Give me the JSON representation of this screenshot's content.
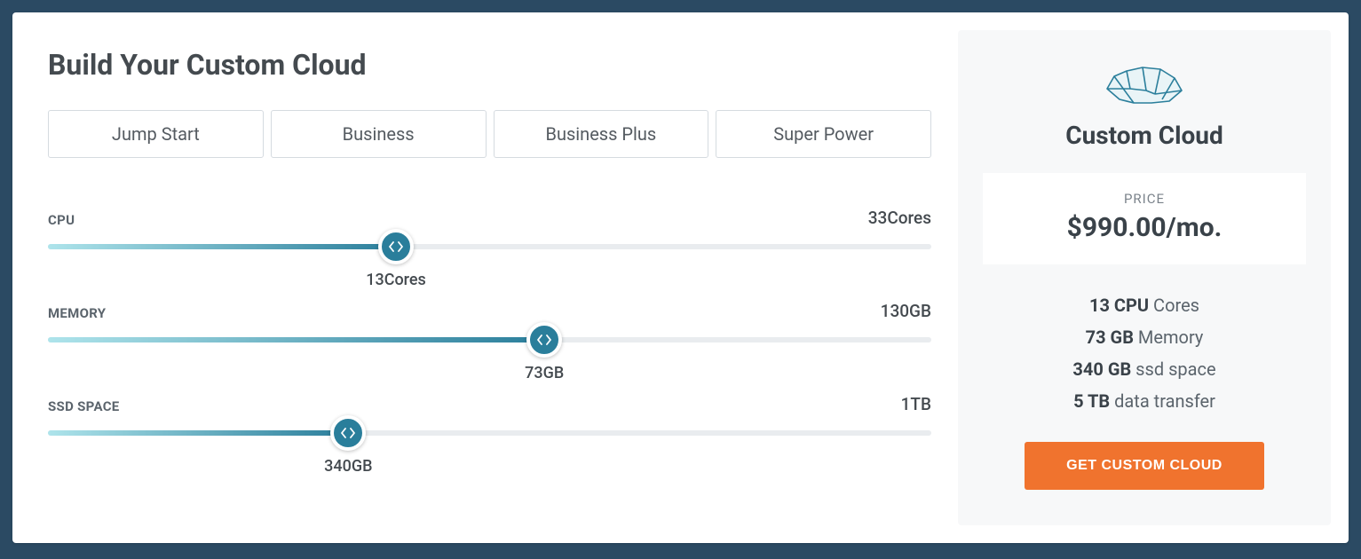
{
  "title": "Build Your Custom Cloud",
  "tabs": [
    {
      "label": "Jump Start"
    },
    {
      "label": "Business"
    },
    {
      "label": "Business Plus"
    },
    {
      "label": "Super Power"
    }
  ],
  "sliders": {
    "cpu": {
      "label": "CPU",
      "max_label": "33Cores",
      "value_label": "13Cores",
      "percent": 39.4
    },
    "memory": {
      "label": "MEMORY",
      "max_label": "130GB",
      "value_label": "73GB",
      "percent": 56.2
    },
    "ssd": {
      "label": "SSD SPACE",
      "max_label": "1TB",
      "value_label": "340GB",
      "percent": 34.0
    }
  },
  "summary": {
    "heading": "Custom Cloud",
    "price_label": "PRICE",
    "price_value": "$990.00/mo.",
    "specs": {
      "cpu_value": "13 CPU",
      "cpu_text": " Cores",
      "mem_value": "73 GB",
      "mem_text": " Memory",
      "ssd_value": "340 GB",
      "ssd_text": " ssd space",
      "dt_value": "5 TB",
      "dt_text": " data transfer"
    },
    "cta": "GET CUSTOM CLOUD"
  },
  "colors": {
    "accent": "#2a7e9b",
    "cta": "#f0732e"
  }
}
